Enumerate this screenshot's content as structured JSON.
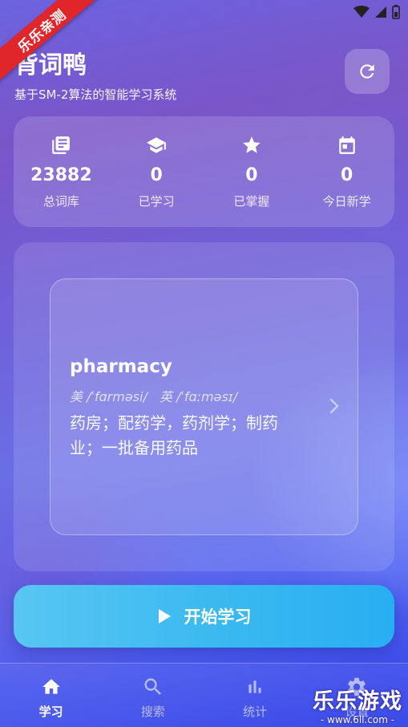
{
  "ribbon": {
    "text": "乐乐亲测"
  },
  "header": {
    "title": "背词鸭",
    "subtitle": "基于SM-2算法的智能学习系统",
    "refresh_icon": "refresh-icon"
  },
  "stats": [
    {
      "icon": "book-icon",
      "value": "23882",
      "label": "总词库"
    },
    {
      "icon": "graduation-cap-icon",
      "value": "0",
      "label": "已学习"
    },
    {
      "icon": "star-icon",
      "value": "0",
      "label": "已掌握"
    },
    {
      "icon": "calendar-icon",
      "value": "0",
      "label": "今日新学"
    }
  ],
  "word_card": {
    "word": "pharmacy",
    "phonetic_us": "美 /ˈfɑrməsi/",
    "phonetic_uk": "英 /ˈfɑːməsɪ/",
    "definition": "药房；配药学，药剂学；制药业；一批备用药品"
  },
  "start_button": {
    "label": "开始学习",
    "icon": "play-icon"
  },
  "nav": [
    {
      "icon": "home-icon",
      "label": "学习",
      "active": true
    },
    {
      "icon": "search-icon",
      "label": "搜索",
      "active": false
    },
    {
      "icon": "bar-chart-icon",
      "label": "统计",
      "active": false
    },
    {
      "icon": "gear-icon",
      "label": "设置",
      "active": false
    }
  ],
  "watermark": {
    "main": "乐乐游戏",
    "sub": "- www.6ll.com -"
  },
  "colors": {
    "accent_start": "#58c6f2",
    "accent_end": "#28aef2",
    "ribbon": "#e0262a"
  }
}
